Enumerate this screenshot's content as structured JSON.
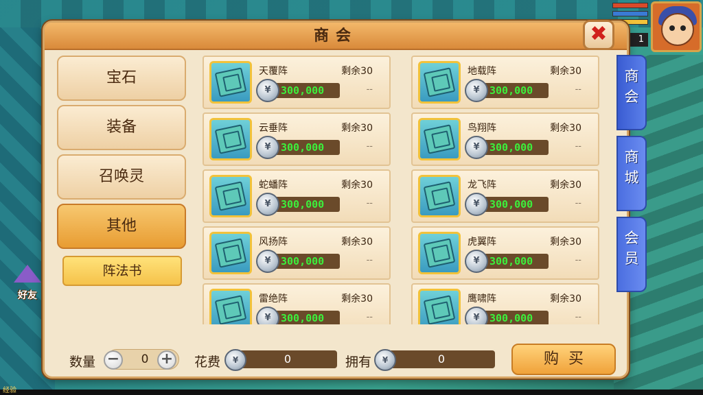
{
  "window": {
    "title": "商会",
    "close_glyph": "✖"
  },
  "hud": {
    "level": "1",
    "bars": [
      "#d94a2a",
      "#3a7bd5",
      "#f3c33a"
    ],
    "friend_label": "好友",
    "exp_label": "经验"
  },
  "categories": [
    {
      "label": "宝石",
      "active": false
    },
    {
      "label": "装备",
      "active": false
    },
    {
      "label": "召唤灵",
      "active": false
    },
    {
      "label": "其他",
      "active": true
    }
  ],
  "subcategory": {
    "label": "阵法书"
  },
  "items": [
    {
      "name": "天覆阵",
      "stock": "剩余30",
      "price": "300,000",
      "extra": "--"
    },
    {
      "name": "地载阵",
      "stock": "剩余30",
      "price": "300,000",
      "extra": "--"
    },
    {
      "name": "云垂阵",
      "stock": "剩余30",
      "price": "300,000",
      "extra": "--"
    },
    {
      "name": "鸟翔阵",
      "stock": "剩余30",
      "price": "300,000",
      "extra": "--"
    },
    {
      "name": "蛇蟠阵",
      "stock": "剩余30",
      "price": "300,000",
      "extra": "--"
    },
    {
      "name": "龙飞阵",
      "stock": "剩余30",
      "price": "300,000",
      "extra": "--"
    },
    {
      "name": "风扬阵",
      "stock": "剩余30",
      "price": "300,000",
      "extra": "--"
    },
    {
      "name": "虎翼阵",
      "stock": "剩余30",
      "price": "300,000",
      "extra": "--"
    },
    {
      "name": "雷绝阵",
      "stock": "剩余30",
      "price": "300,000",
      "extra": "--"
    },
    {
      "name": "鹰啸阵",
      "stock": "剩余30",
      "price": "300,000",
      "extra": "--"
    }
  ],
  "controls": {
    "qty_label": "数量",
    "qty_value": "0",
    "minus": "−",
    "plus": "+",
    "cost_label": "花费",
    "cost_value": "0",
    "owned_label": "拥有",
    "owned_value": "0",
    "buy_label": "购买"
  },
  "side_tabs": [
    {
      "label": "商会",
      "active": true
    },
    {
      "label": "商城",
      "active": false
    },
    {
      "label": "会员",
      "active": false
    }
  ],
  "colors": {
    "accent": "#e89c32",
    "price_text": "#3cf03c",
    "side_tab": "#4b6ee0",
    "close_x": "#d0211c"
  }
}
